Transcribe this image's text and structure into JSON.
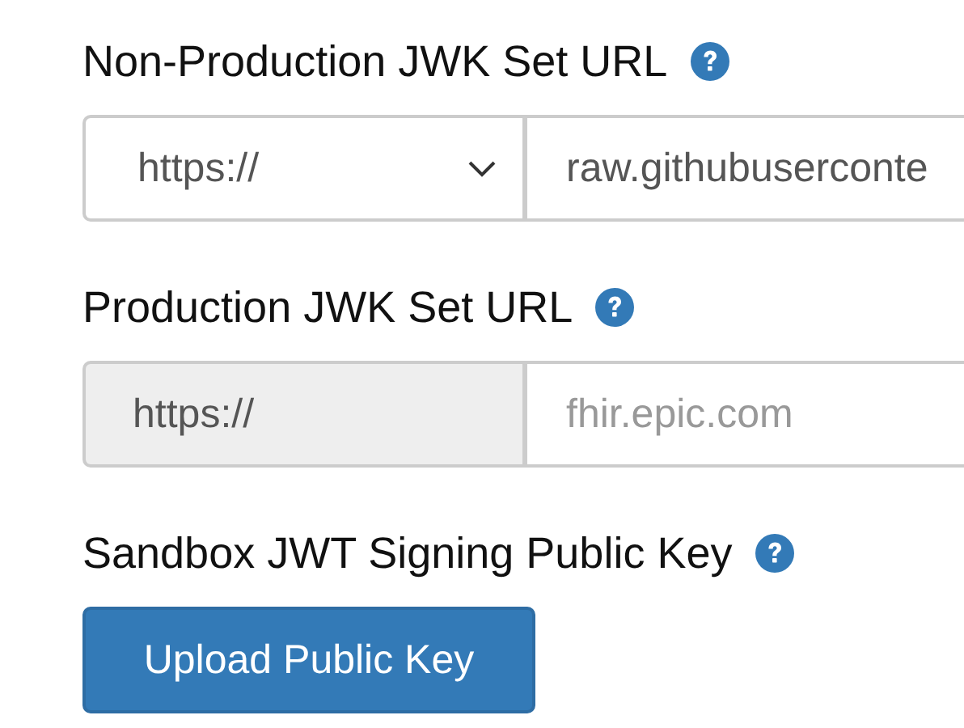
{
  "fields": [
    {
      "label": "Non-Production JWK Set URL",
      "scheme": {
        "kind": "select",
        "value": "https://"
      },
      "url": {
        "value": "raw.githubuserconte"
      }
    },
    {
      "label": "Production JWK Set URL",
      "scheme": {
        "kind": "addon",
        "value": "https://"
      },
      "url": {
        "placeholder": "fhir.epic.com"
      }
    }
  ],
  "public_key": {
    "label": "Sandbox JWT Signing Public Key",
    "button": "Upload Public Key"
  }
}
